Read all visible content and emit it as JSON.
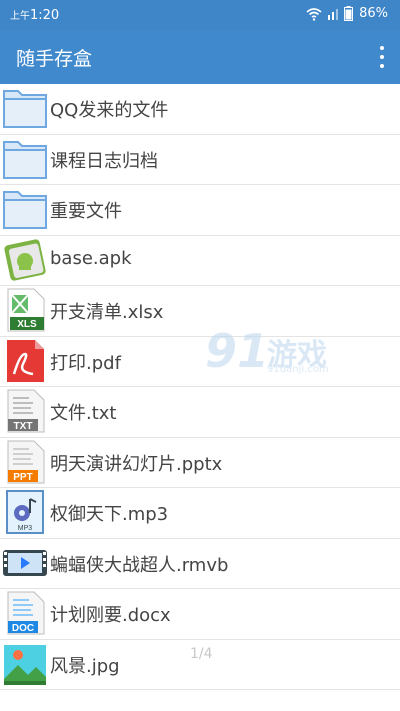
{
  "status_bar": {
    "time_prefix": "上午",
    "time": "1:20",
    "battery": "86%",
    "icons": [
      "wifi-icon",
      "signal-icon",
      "battery-icon"
    ]
  },
  "app_bar": {
    "title": "随手存盒",
    "menu_icon": "more-vert-icon"
  },
  "files": [
    {
      "name": "QQ发来的文件",
      "icon": "folder-icon"
    },
    {
      "name": "课程日志归档",
      "icon": "folder-icon"
    },
    {
      "name": "重要文件",
      "icon": "folder-icon"
    },
    {
      "name": "base.apk",
      "icon": "apk-icon"
    },
    {
      "name": "开支清单.xlsx",
      "icon": "xls-icon",
      "tag": "XLS"
    },
    {
      "name": "打印.pdf",
      "icon": "pdf-icon"
    },
    {
      "name": "文件.txt",
      "icon": "txt-icon",
      "tag": "TXT"
    },
    {
      "name": "明天演讲幻灯片.pptx",
      "icon": "ppt-icon",
      "tag": "PPT"
    },
    {
      "name": "权御天下.mp3",
      "icon": "mp3-icon",
      "tag": "MP3"
    },
    {
      "name": "蝙蝠侠大战超人.rmvb",
      "icon": "video-icon"
    },
    {
      "name": "计划刚要.docx",
      "icon": "doc-icon",
      "tag": "DOC"
    },
    {
      "name": "风景.jpg",
      "icon": "image-icon"
    }
  ],
  "pager": "1/4",
  "watermark": {
    "number": "91",
    "text": "游戏",
    "url": "91danji.com"
  },
  "colors": {
    "primary": "#4189cd",
    "status": "#3f86c9",
    "folder": "#6fa8e0"
  }
}
